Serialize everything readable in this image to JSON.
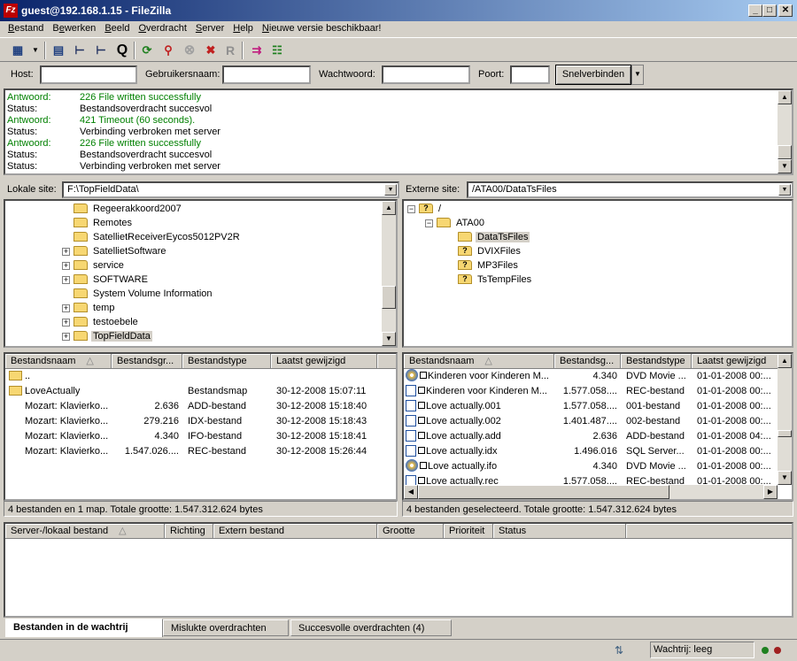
{
  "window": {
    "title": "guest@192.168.1.15 - FileZilla",
    "app_icon": "Fz"
  },
  "menu": [
    {
      "pre": "",
      "u": "B",
      "post": "estand"
    },
    {
      "pre": "B",
      "u": "e",
      "post": "werken"
    },
    {
      "pre": "",
      "u": "B",
      "post": "eeld"
    },
    {
      "pre": "",
      "u": "O",
      "post": "verdracht"
    },
    {
      "pre": "",
      "u": "S",
      "post": "erver"
    },
    {
      "pre": "",
      "u": "H",
      "post": "elp"
    },
    {
      "pre": "",
      "u": "N",
      "post": "ieuwe versie beschikbaar!"
    }
  ],
  "quickconnect": {
    "host_label": "Host:",
    "user_label": "Gebruikersnaam:",
    "pass_label": "Wachtwoord:",
    "port_label": "Poort:",
    "button_label": "Snelverbinden",
    "host_value": "",
    "user_value": "",
    "pass_value": "",
    "port_value": ""
  },
  "log": [
    {
      "type": "Antwoord:",
      "msg": "226 File written successfully",
      "color": "#008000"
    },
    {
      "type": "Status:",
      "msg": "Bestandsoverdracht succesvol",
      "color": "#000000"
    },
    {
      "type": "Antwoord:",
      "msg": "421 Timeout (60 seconds).",
      "color": "#008000"
    },
    {
      "type": "Status:",
      "msg": "Verbinding verbroken met server",
      "color": "#000000"
    },
    {
      "type": "Antwoord:",
      "msg": "226 File written successfully",
      "color": "#008000"
    },
    {
      "type": "Status:",
      "msg": "Bestandsoverdracht succesvol",
      "color": "#000000"
    },
    {
      "type": "Status:",
      "msg": "Verbinding verbroken met server",
      "color": "#000000"
    }
  ],
  "local": {
    "site_label": "Lokale site:",
    "path": "F:\\TopFieldData\\",
    "tree": [
      {
        "name": "Regeerakkoord2007",
        "expander": ""
      },
      {
        "name": "Remotes",
        "expander": ""
      },
      {
        "name": "SatellietReceiverEycos5012PV2R",
        "expander": ""
      },
      {
        "name": "SatellietSoftware",
        "expander": "+"
      },
      {
        "name": "service",
        "expander": "+"
      },
      {
        "name": "SOFTWARE",
        "expander": "+"
      },
      {
        "name": "System Volume Information",
        "expander": ""
      },
      {
        "name": "temp",
        "expander": "+"
      },
      {
        "name": "testoebele",
        "expander": "+"
      },
      {
        "name": "TopFieldData",
        "expander": "+"
      }
    ],
    "columns": [
      "Bestandsnaam",
      "Bestandsgr...",
      "Bestandstype",
      "Laatst gewijzigd"
    ],
    "files": [
      {
        "name": "..",
        "size": "",
        "type": "",
        "date": ""
      },
      {
        "name": "LoveActually",
        "size": "",
        "type": "Bestandsmap",
        "date": "30-12-2008 15:07:11"
      },
      {
        "name": "Mozart: Klavierko...",
        "size": "2.636",
        "type": "ADD-bestand",
        "date": "30-12-2008 15:18:40"
      },
      {
        "name": "Mozart: Klavierko...",
        "size": "279.216",
        "type": "IDX-bestand",
        "date": "30-12-2008 15:18:43"
      },
      {
        "name": "Mozart: Klavierko...",
        "size": "4.340",
        "type": "IFO-bestand",
        "date": "30-12-2008 15:18:41"
      },
      {
        "name": "Mozart: Klavierko...",
        "size": "1.547.026....",
        "type": "REC-bestand",
        "date": "30-12-2008 15:26:44"
      }
    ],
    "status": "4 bestanden en 1 map. Totale grootte: 1.547.312.624 bytes"
  },
  "remote": {
    "site_label": "Externe site:",
    "path": "/ATA00/DataTsFiles",
    "tree": [
      {
        "name": "/",
        "expander": "−"
      },
      {
        "name": "ATA00",
        "expander": "−"
      },
      {
        "name": "DataTsFiles",
        "expander": ""
      },
      {
        "name": "DVIXFiles",
        "expander": ""
      },
      {
        "name": "MP3Files",
        "expander": ""
      },
      {
        "name": "TsTempFiles",
        "expander": ""
      }
    ],
    "columns": [
      "Bestandsnaam",
      "Bestandsg...",
      "Bestandstype",
      "Laatst gewijzigd"
    ],
    "files": [
      {
        "name": "Kinderen voor Kinderen M...",
        "size": "4.340",
        "type": "DVD Movie ...",
        "date": "01-01-2008 00:...",
        "icon": "disc"
      },
      {
        "name": "Kinderen voor Kinderen M...",
        "size": "1.577.058....",
        "type": "REC-bestand",
        "date": "01-01-2008 00:...",
        "icon": "file"
      },
      {
        "name": "Love actually.001",
        "size": "1.577.058....",
        "type": "001-bestand",
        "date": "01-01-2008 00:...",
        "icon": "file"
      },
      {
        "name": "Love actually.002",
        "size": "1.401.487....",
        "type": "002-bestand",
        "date": "01-01-2008 00:...",
        "icon": "file"
      },
      {
        "name": "Love actually.add",
        "size": "2.636",
        "type": "ADD-bestand",
        "date": "01-01-2008 04:...",
        "icon": "file"
      },
      {
        "name": "Love actually.idx",
        "size": "1.496.016",
        "type": "SQL Server...",
        "date": "01-01-2008 00:...",
        "icon": "file"
      },
      {
        "name": "Love actually.ifo",
        "size": "4.340",
        "type": "DVD Movie ...",
        "date": "01-01-2008 00:...",
        "icon": "disc"
      },
      {
        "name": "Love actually.rec",
        "size": "1.577.058....",
        "type": "REC-bestand",
        "date": "01-01-2008 00:...",
        "icon": "file"
      }
    ],
    "status": "4 bestanden geselecteerd. Totale grootte: 1.547.312.624 bytes"
  },
  "queue": {
    "columns": [
      "Server-/lokaal bestand",
      "Richting",
      "Extern bestand",
      "Grootte",
      "Prioriteit",
      "Status"
    ],
    "tabs": [
      "Bestanden in de wachtrij",
      "Mislukte overdrachten",
      "Succesvolle overdrachten (4)"
    ],
    "status": "Wachtrij: leeg"
  },
  "colors": {
    "log_response": "#008000",
    "title_start": "#0a246a",
    "title_end": "#a6caf0"
  }
}
